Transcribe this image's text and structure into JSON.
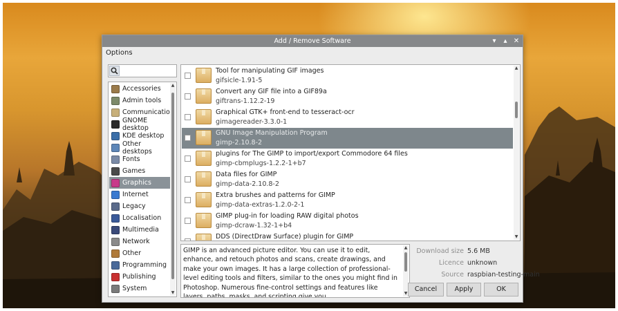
{
  "window": {
    "title": "Add / Remove Software",
    "controls": [
      "▾",
      "▴",
      "✕"
    ]
  },
  "menu": {
    "options": "Options"
  },
  "search": {
    "value": "",
    "placeholder": "",
    "icon": "search-icon"
  },
  "categories": [
    {
      "label": "Accessories",
      "icon": "accessories-icon",
      "color": "#9a7a4a",
      "selected": false
    },
    {
      "label": "Admin tools",
      "icon": "admin-tools-icon",
      "color": "#7d8a6a",
      "selected": false
    },
    {
      "label": "Communication",
      "icon": "communication-icon",
      "color": "#c8b07a",
      "selected": false
    },
    {
      "label": "GNOME desktop",
      "icon": "gnome-icon",
      "color": "#2a2a2a",
      "selected": false
    },
    {
      "label": "KDE desktop",
      "icon": "kde-icon",
      "color": "#3a6ea8",
      "selected": false
    },
    {
      "label": "Other desktops",
      "icon": "desktops-icon",
      "color": "#5d86b8",
      "selected": false
    },
    {
      "label": "Fonts",
      "icon": "fonts-icon",
      "color": "#7a8aa6",
      "selected": false
    },
    {
      "label": "Games",
      "icon": "games-icon",
      "color": "#4a4a4a",
      "selected": false
    },
    {
      "label": "Graphics",
      "icon": "graphics-icon",
      "color": "#c83a8a",
      "selected": true
    },
    {
      "label": "Internet",
      "icon": "internet-icon",
      "color": "#3a7ad0",
      "selected": false
    },
    {
      "label": "Legacy",
      "icon": "legacy-icon",
      "color": "#5a6a8a",
      "selected": false
    },
    {
      "label": "Localisation",
      "icon": "localisation-icon",
      "color": "#3a5a9a",
      "selected": false
    },
    {
      "label": "Multimedia",
      "icon": "multimedia-icon",
      "color": "#3a4a7a",
      "selected": false
    },
    {
      "label": "Network",
      "icon": "network-icon",
      "color": "#8a8a8a",
      "selected": false
    },
    {
      "label": "Other",
      "icon": "other-icon",
      "color": "#b07a3a",
      "selected": false
    },
    {
      "label": "Programming",
      "icon": "programming-icon",
      "color": "#4a6a9a",
      "selected": false
    },
    {
      "label": "Publishing",
      "icon": "publishing-icon",
      "color": "#c83030",
      "selected": false
    },
    {
      "label": "System",
      "icon": "system-icon",
      "color": "#7a7a7a",
      "selected": false
    }
  ],
  "packages": [
    {
      "name": "Tool for manipulating GIF images",
      "version": "gifsicle-1.91-5",
      "checked": false,
      "selected": false
    },
    {
      "name": "Convert any GIF file into a GIF89a",
      "version": "giftrans-1.12.2-19",
      "checked": false,
      "selected": false
    },
    {
      "name": "Graphical GTK+ front-end to tesseract-ocr",
      "version": "gimagereader-3.3.0-1",
      "checked": false,
      "selected": false
    },
    {
      "name": "GNU Image Manipulation Program",
      "version": "gimp-2.10.8-2",
      "checked": false,
      "selected": true
    },
    {
      "name": "plugins for The GIMP to import/export Commodore 64 files",
      "version": "gimp-cbmplugs-1.2.2-1+b7",
      "checked": false,
      "selected": false
    },
    {
      "name": "Data files for GIMP",
      "version": "gimp-data-2.10.8-2",
      "checked": false,
      "selected": false
    },
    {
      "name": "Extra brushes and patterns for GIMP",
      "version": "gimp-data-extras-1.2.0-2-1",
      "checked": false,
      "selected": false
    },
    {
      "name": "GIMP plug-in for loading RAW digital photos",
      "version": "gimp-dcraw-1.32-1+b4",
      "checked": false,
      "selected": false
    },
    {
      "name": "DDS (DirectDraw Surface) plugin for GIMP",
      "version": "",
      "checked": false,
      "selected": false
    }
  ],
  "description": "GIMP is an advanced picture editor. You can use it to edit, enhance, and retouch photos and scans, create drawings, and make your own images. It has a large collection of professional-level editing tools and filters, similar to the ones you might find in Photoshop. Numerous fine-control settings and features like layers, paths, masks, and scripting give you",
  "info": {
    "download_size_label": "Download size",
    "download_size_value": "5.6 MB",
    "licence_label": "Licence",
    "licence_value": "unknown",
    "source_label": "Source",
    "source_value": "raspbian-testing-main"
  },
  "buttons": {
    "cancel": "Cancel",
    "apply": "Apply",
    "ok": "OK"
  }
}
